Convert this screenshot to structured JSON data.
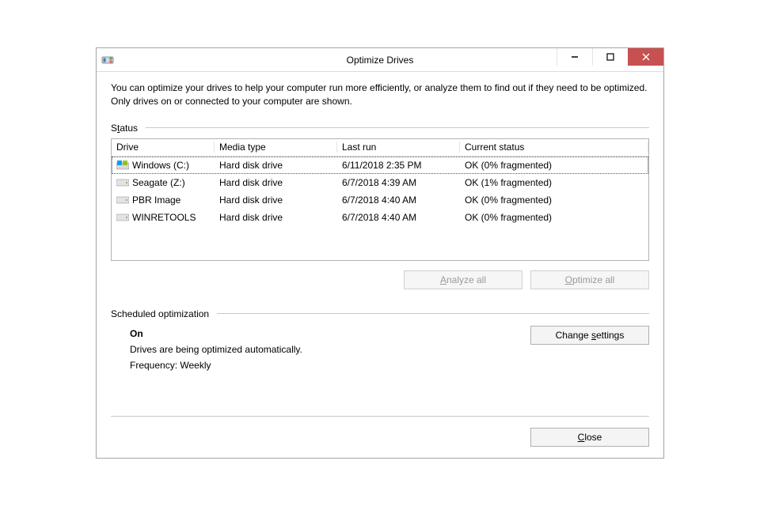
{
  "window": {
    "title": "Optimize Drives"
  },
  "intro": "You can optimize your drives to help your computer run more efficiently, or analyze them to find out if they need to be optimized. Only drives on or connected to your computer are shown.",
  "status_label": {
    "pre": "S",
    "ul": "t",
    "post": "atus"
  },
  "columns": {
    "drive": "Drive",
    "media": "Media type",
    "last": "Last run",
    "status": "Current status"
  },
  "drives": [
    {
      "name": "Windows (C:)",
      "icon": "windows",
      "media": "Hard disk drive",
      "last": "6/11/2018 2:35 PM",
      "status": "OK (0% fragmented)",
      "selected": true
    },
    {
      "name": "Seagate (Z:)",
      "icon": "hdd",
      "media": "Hard disk drive",
      "last": "6/7/2018 4:39 AM",
      "status": "OK (1% fragmented)",
      "selected": false
    },
    {
      "name": "PBR Image",
      "icon": "hdd",
      "media": "Hard disk drive",
      "last": "6/7/2018 4:40 AM",
      "status": "OK (0% fragmented)",
      "selected": false
    },
    {
      "name": "WINRETOOLS",
      "icon": "hdd",
      "media": "Hard disk drive",
      "last": "6/7/2018 4:40 AM",
      "status": "OK (0% fragmented)",
      "selected": false
    }
  ],
  "buttons": {
    "analyze": {
      "ul": "A",
      "post": "nalyze all"
    },
    "optimize": {
      "ul": "O",
      "post": "ptimize all"
    },
    "change": {
      "pre": "Change ",
      "ul": "s",
      "post": "ettings"
    },
    "close": {
      "ul": "C",
      "post": "lose"
    }
  },
  "sched": {
    "label": "Scheduled optimization",
    "on": "On",
    "line1": "Drives are being optimized automatically.",
    "line2": "Frequency: Weekly"
  }
}
